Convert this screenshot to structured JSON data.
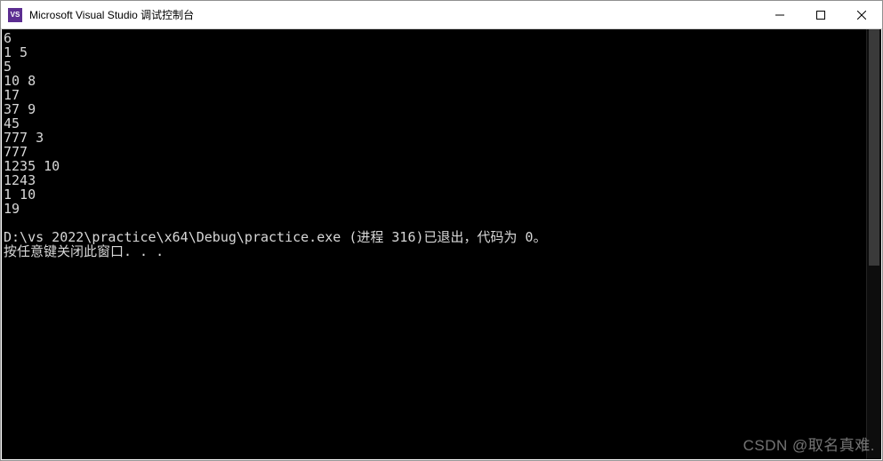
{
  "window": {
    "title": "Microsoft Visual Studio 调试控制台",
    "icon_label": "VS"
  },
  "console": {
    "lines": [
      "6",
      "1 5",
      "5",
      "10 8",
      "17",
      "37 9",
      "45",
      "777 3",
      "777",
      "1235 10",
      "1243",
      "1 10",
      "19",
      "",
      "D:\\vs 2022\\practice\\x64\\Debug\\practice.exe (进程 316)已退出，代码为 0。",
      "按任意键关闭此窗口. . ."
    ]
  },
  "watermark": "CSDN @取名真难."
}
